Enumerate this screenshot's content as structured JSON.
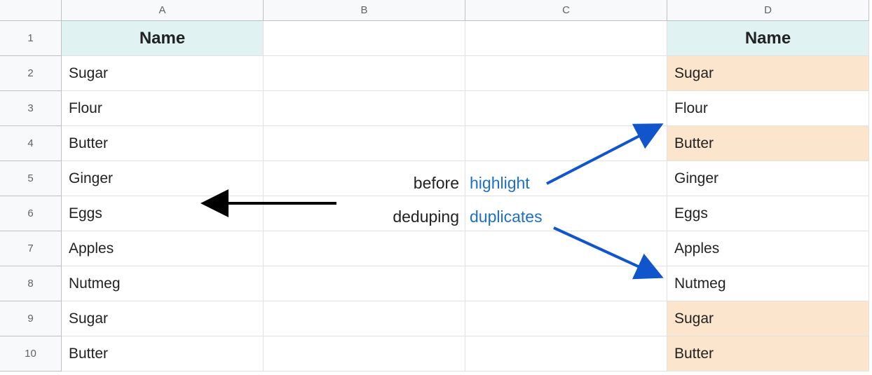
{
  "columns": [
    "A",
    "B",
    "C",
    "D"
  ],
  "rows": [
    "1",
    "2",
    "3",
    "4",
    "5",
    "6",
    "7",
    "8",
    "9",
    "10"
  ],
  "grid": {
    "A1": {
      "text": "Name",
      "header": true
    },
    "D1": {
      "text": "Name",
      "header": true
    },
    "A2": {
      "text": "Sugar"
    },
    "A3": {
      "text": "Flour"
    },
    "A4": {
      "text": "Butter"
    },
    "A5": {
      "text": "Ginger"
    },
    "A6": {
      "text": "Eggs"
    },
    "A7": {
      "text": "Apples"
    },
    "A8": {
      "text": "Nutmeg"
    },
    "A9": {
      "text": "Sugar"
    },
    "A10": {
      "text": "Butter"
    },
    "D2": {
      "text": "Sugar",
      "highlighted": true
    },
    "D3": {
      "text": "Flour"
    },
    "D4": {
      "text": "Butter",
      "highlighted": true
    },
    "D5": {
      "text": "Ginger"
    },
    "D6": {
      "text": "Eggs"
    },
    "D7": {
      "text": "Apples"
    },
    "D8": {
      "text": "Nutmeg"
    },
    "D9": {
      "text": "Sugar",
      "highlighted": true
    },
    "D10": {
      "text": "Butter",
      "highlighted": true
    }
  },
  "annotations": {
    "before_line1": "before",
    "before_line2": "deduping",
    "highlight_line1": "highlight",
    "highlight_line2": "duplicates"
  },
  "colors": {
    "header_bg": "#e1f2f2",
    "highlight_bg": "#fce5cd",
    "link_color": "#1c6fca",
    "arrow_black": "#000000",
    "arrow_blue": "#1155cc"
  }
}
